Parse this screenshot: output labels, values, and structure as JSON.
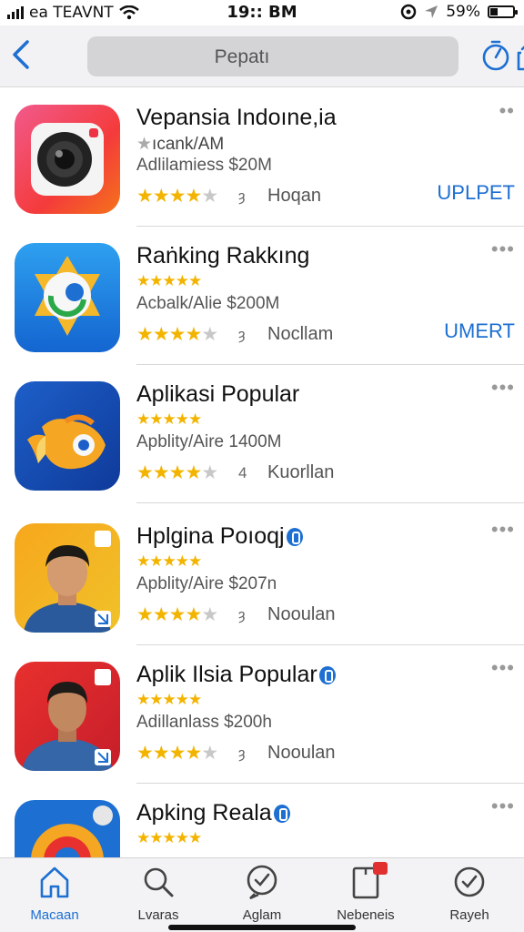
{
  "status_bar": {
    "carrier": "ea TEAVNT",
    "time": "19:: BM",
    "battery": "59%"
  },
  "header": {
    "search_text": "Pepatı"
  },
  "apps": [
    {
      "title": "Vepansia Indoıne,ia",
      "sub1": "ıcank/AM",
      "sub2": "Adlilamiess $20M",
      "rating": 4,
      "rating_count": "ȝ",
      "rating_label": "Hoqan",
      "action": "UPLPET",
      "icon": "camera-app-icon"
    },
    {
      "title": "Raṅking Rakkıng",
      "sub2": "Acbalk/Alie $200M",
      "rating": 4,
      "rating_count": "ȝ",
      "rating_label": "Nocllam",
      "action": "UMERT",
      "icon": "chrome-star-app-icon"
    },
    {
      "title": "Aplikasi Popular",
      "sub2": "Apblity/Aire 1400M",
      "rating": 4,
      "rating_count": "4",
      "rating_label": "Kuorllan",
      "action": "",
      "icon": "fish-app-icon"
    },
    {
      "title": "Hplgina Poıoqj",
      "sub2": "Apblity/Aire $207n",
      "rating": 4,
      "rating_count": "ȝ",
      "rating_label": "Nooulan",
      "action": "",
      "icon": "man-portrait-orange-icon",
      "verified": true
    },
    {
      "title": "Aplik Ilsia Popular",
      "sub2": "Adillanlass $200h",
      "rating": 4,
      "rating_count": "ȝ",
      "rating_label": "Nooulan",
      "action": "",
      "icon": "man-portrait-red-icon",
      "verified": true
    },
    {
      "title": "Apking Reala",
      "rating": 5,
      "icon": "orange-swirl-app-icon",
      "verified": true
    }
  ],
  "tabs": [
    {
      "label": "Macaan",
      "icon": "home-icon",
      "active": true
    },
    {
      "label": "Lvaras",
      "icon": "search-icon"
    },
    {
      "label": "Aglam",
      "icon": "check-bubble-icon"
    },
    {
      "label": "Nebeneis",
      "icon": "tablet-icon"
    },
    {
      "label": "Rayeh",
      "icon": "check-circle-icon"
    }
  ],
  "colors": {
    "accent": "#1d6fd2",
    "star": "#f3b400",
    "search_bg": "#d4d4d7"
  }
}
